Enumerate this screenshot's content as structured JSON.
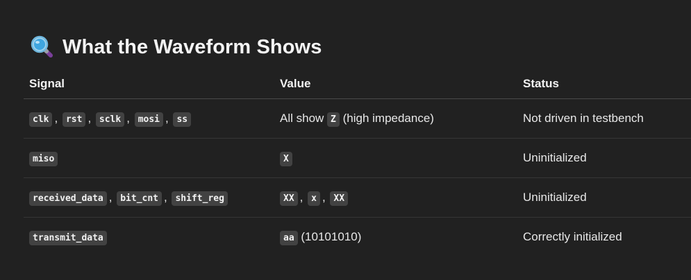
{
  "section": {
    "emoji_icon": "magnifying-glass-icon",
    "title": "What the Waveform Shows"
  },
  "table": {
    "headers": [
      "Signal",
      "Value",
      "Status"
    ],
    "rows": [
      {
        "signals": [
          "clk",
          "rst",
          "sclk",
          "mosi",
          "ss"
        ],
        "value_prefix": "All show",
        "value_code": "Z",
        "value_suffix": "(high impedance)",
        "status": "Not driven in testbench"
      },
      {
        "signals": [
          "miso"
        ],
        "value_code": "X",
        "status": "Uninitialized"
      },
      {
        "signals": [
          "received_data",
          "bit_cnt",
          "shift_reg"
        ],
        "value_codes": [
          "XX",
          "x",
          "XX"
        ],
        "status": "Uninitialized"
      },
      {
        "signals": [
          "transmit_data"
        ],
        "value_code": "aa",
        "value_suffix": "(10101010)",
        "status": "Correctly initialized"
      }
    ],
    "separator": ","
  },
  "colors": {
    "background": "#212121",
    "code_background": "#424242",
    "text": "#ececec"
  }
}
